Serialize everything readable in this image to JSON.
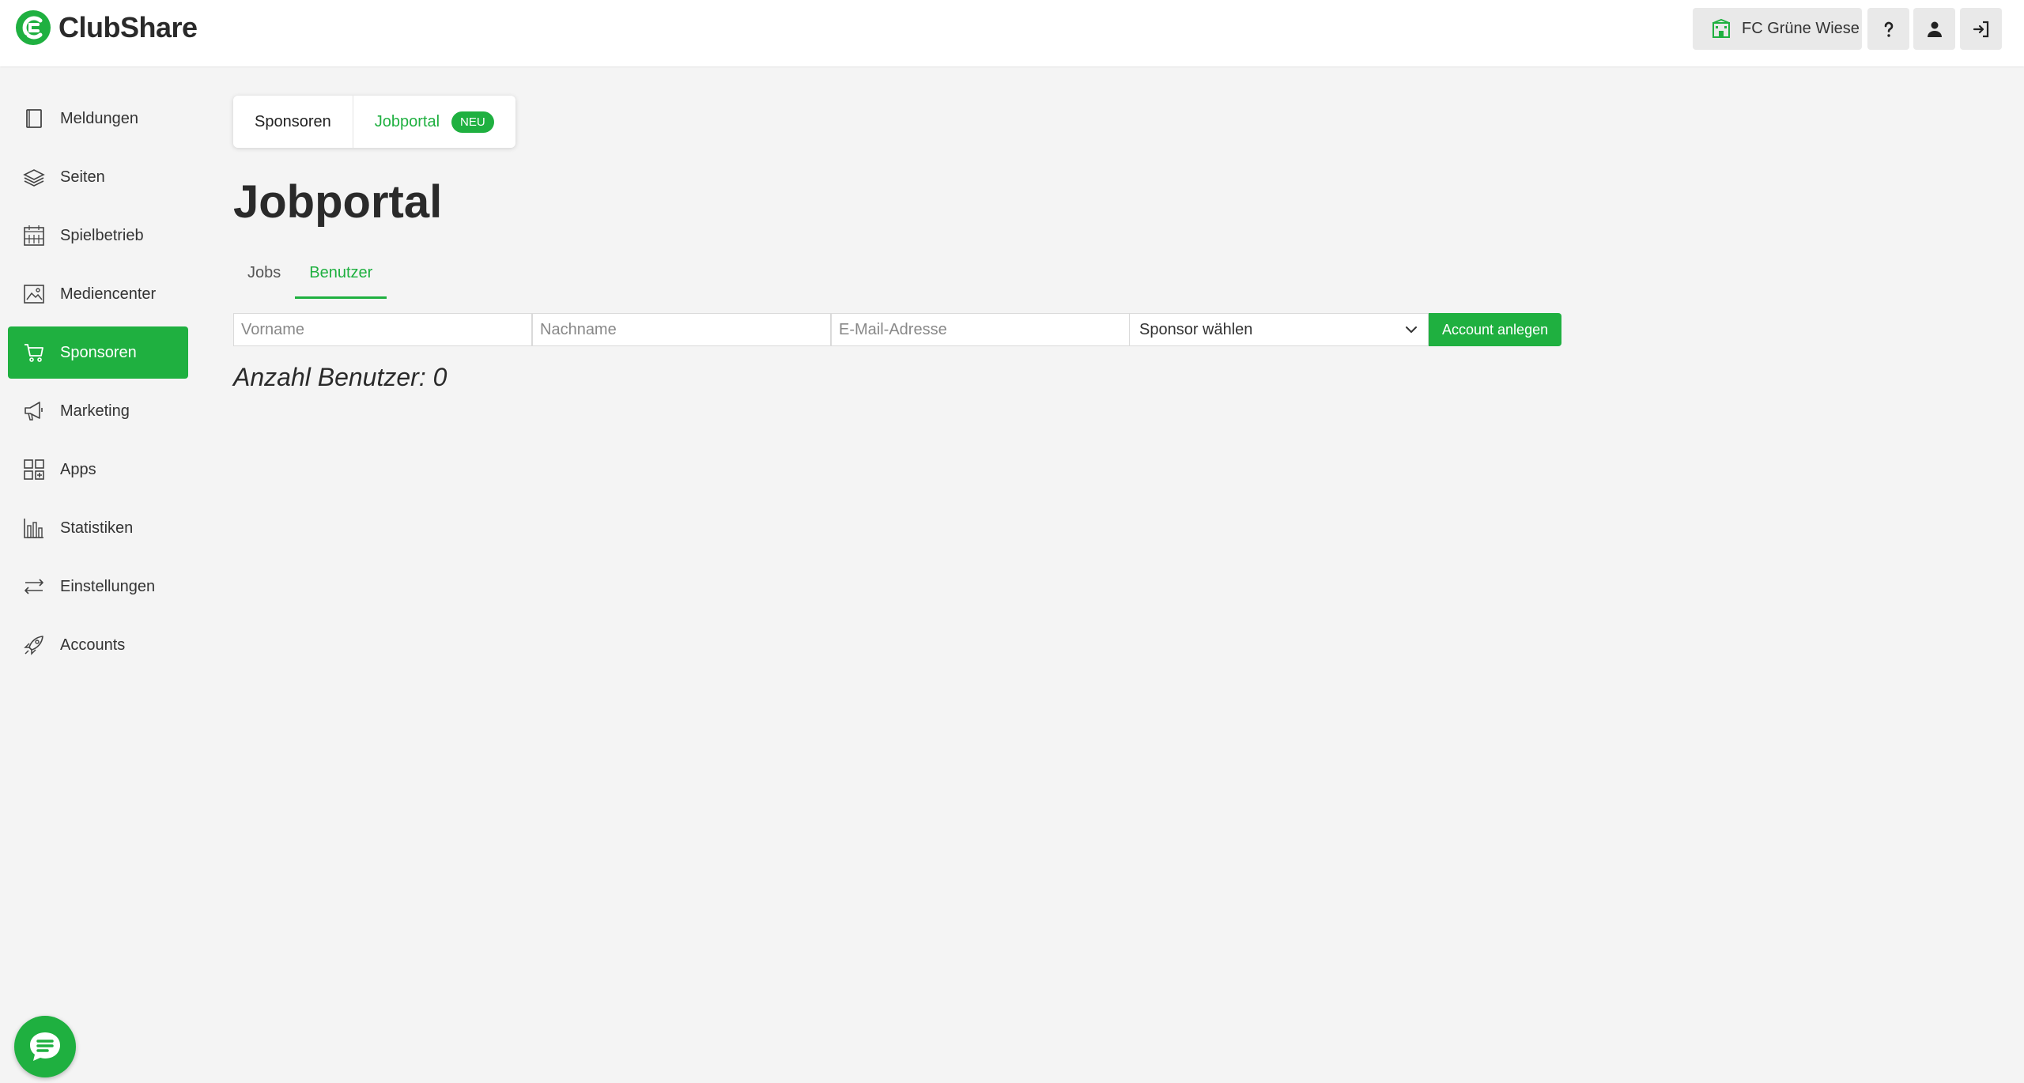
{
  "app": {
    "name": "ClubShare"
  },
  "header": {
    "club_name": "FC Grüne Wiese",
    "help_icon": "question-icon",
    "user_icon": "user-icon",
    "logout_icon": "logout-icon"
  },
  "sidebar": {
    "items": [
      {
        "label": "Meldungen",
        "icon": "book-icon"
      },
      {
        "label": "Seiten",
        "icon": "layers-icon"
      },
      {
        "label": "Spielbetrieb",
        "icon": "calendar-icon"
      },
      {
        "label": "Mediencenter",
        "icon": "image-icon"
      },
      {
        "label": "Sponsoren",
        "icon": "cart-icon",
        "active": true
      },
      {
        "label": "Marketing",
        "icon": "megaphone-icon"
      },
      {
        "label": "Apps",
        "icon": "apps-grid-icon"
      },
      {
        "label": "Statistiken",
        "icon": "bar-chart-icon"
      },
      {
        "label": "Einstellungen",
        "icon": "sliders-icon"
      },
      {
        "label": "Accounts",
        "icon": "rocket-icon"
      }
    ]
  },
  "subnav": {
    "items": [
      {
        "label": "Sponsoren"
      },
      {
        "label": "Jobportal",
        "badge": "NEU",
        "active": true
      }
    ]
  },
  "page": {
    "title": "Jobportal",
    "tabs": [
      {
        "label": "Jobs"
      },
      {
        "label": "Benutzer",
        "active": true
      }
    ],
    "form": {
      "first_name_placeholder": "Vorname",
      "last_name_placeholder": "Nachname",
      "email_placeholder": "E-Mail-Adresse",
      "sponsor_select_value": "Sponsor wählen",
      "submit_label": "Account anlegen"
    },
    "user_count_text": "Anzahl Benutzer: 0"
  },
  "colors": {
    "accent": "#1fb040",
    "background": "#f4f4f4"
  }
}
